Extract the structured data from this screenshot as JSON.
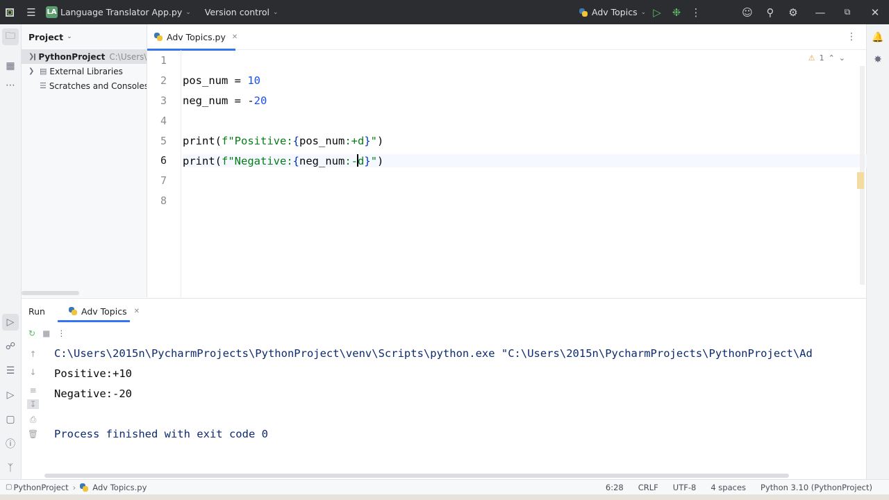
{
  "titlebar": {
    "project_badge": "LA",
    "project_name": "Language Translator App.py",
    "vcs": "Version control",
    "run_config": "Adv Topics",
    "icons": [
      "menu-icon",
      "run-icon",
      "debug-icon",
      "more-icon",
      "add-user-icon",
      "search-icon",
      "settings-icon",
      "minimize-icon",
      "restore-icon",
      "close-icon"
    ]
  },
  "project_pane": {
    "title": "Project",
    "items": [
      {
        "label": "PythonProject",
        "path": "C:\\Users\\"
      },
      {
        "label": "External Libraries"
      },
      {
        "label": "Scratches and Consoles"
      }
    ]
  },
  "editor": {
    "tab": "Adv Topics.py",
    "warning_count": "1",
    "line_numbers": [
      "1",
      "2",
      "3",
      "4",
      "5",
      "6",
      "7",
      "8"
    ],
    "lines": [
      "",
      "pos_num = 10",
      "neg_num = -20",
      "",
      "print(f\"Positive:{pos_num:+d}\")",
      "print(f\"Negative:{neg_num:-d}\")",
      "",
      ""
    ],
    "current_line": 6
  },
  "run": {
    "label": "Run",
    "tab": "Adv Topics",
    "output": [
      "C:\\Users\\2015n\\PycharmProjects\\PythonProject\\venv\\Scripts\\python.exe \"C:\\Users\\2015n\\PycharmProjects\\PythonProject\\Ad",
      "Positive:+10",
      "Negative:-20",
      "",
      "Process finished with exit code 0"
    ]
  },
  "statusbar": {
    "breadcrumb_project": "PythonProject",
    "breadcrumb_file": "Adv Topics.py",
    "position": "6:28",
    "line_sep": "CRLF",
    "encoding": "UTF-8",
    "indent": "4 spaces",
    "interpreter": "Python 3.10 (PythonProject)"
  },
  "colors": {
    "accent": "#3574f0",
    "titlebar": "#2b2d30",
    "number": "#1750eb",
    "string": "#067d17"
  }
}
